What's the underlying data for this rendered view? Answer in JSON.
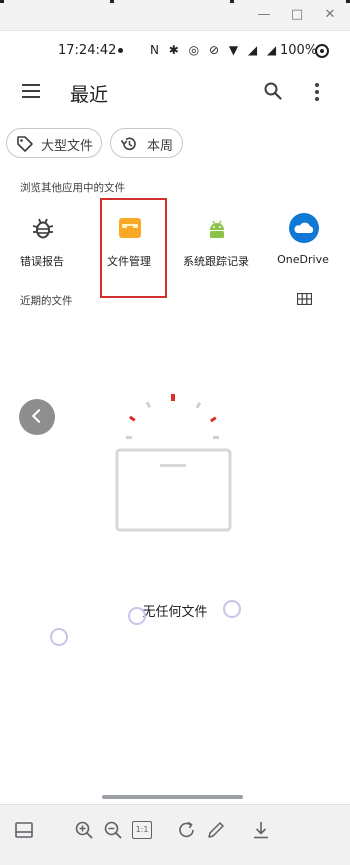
{
  "window": {
    "minimize": "—",
    "maximize": "□",
    "close": "✕"
  },
  "status_bar": {
    "time": "17:24:42",
    "indicator_icons": "N ✱ ◎ ⊘ ▼ ◢ ◢",
    "battery": "100%"
  },
  "app_bar": {
    "title": "最近",
    "menu_icon": "menu-icon",
    "search_icon": "search-icon",
    "more_icon": "more-vert-icon"
  },
  "chips": [
    {
      "label": "大型文件",
      "icon": "tag-icon"
    },
    {
      "label": "本周",
      "icon": "history-icon"
    }
  ],
  "browse_section": {
    "label": "浏览其他应用中的文件",
    "apps": [
      {
        "label": "错误报告",
        "icon": "bug-icon"
      },
      {
        "label": "文件管理",
        "icon": "file-manager-icon"
      },
      {
        "label": "系统跟踪记录",
        "icon": "android-icon"
      },
      {
        "label": "OneDrive",
        "icon": "onedrive-cloud-icon"
      }
    ]
  },
  "recent_section": {
    "label": "近期的文件",
    "view_toggle_icon": "grid-view-icon"
  },
  "empty_state": {
    "text": "无任何文件"
  },
  "bottom_toolbar": {
    "icons": [
      "panel-icon",
      "zoom-in-icon",
      "zoom-out-icon",
      "actual-size-icon",
      "rotate-icon",
      "edit-icon",
      "download-icon"
    ],
    "actual_size_label": "1:1"
  },
  "colors": {
    "highlight_border": "#d32f2f",
    "file_manager_yellow": "#f9a825",
    "android_green": "#8bc34a",
    "onedrive_blue": "#0f78d4",
    "loader_red": "#d93025"
  }
}
